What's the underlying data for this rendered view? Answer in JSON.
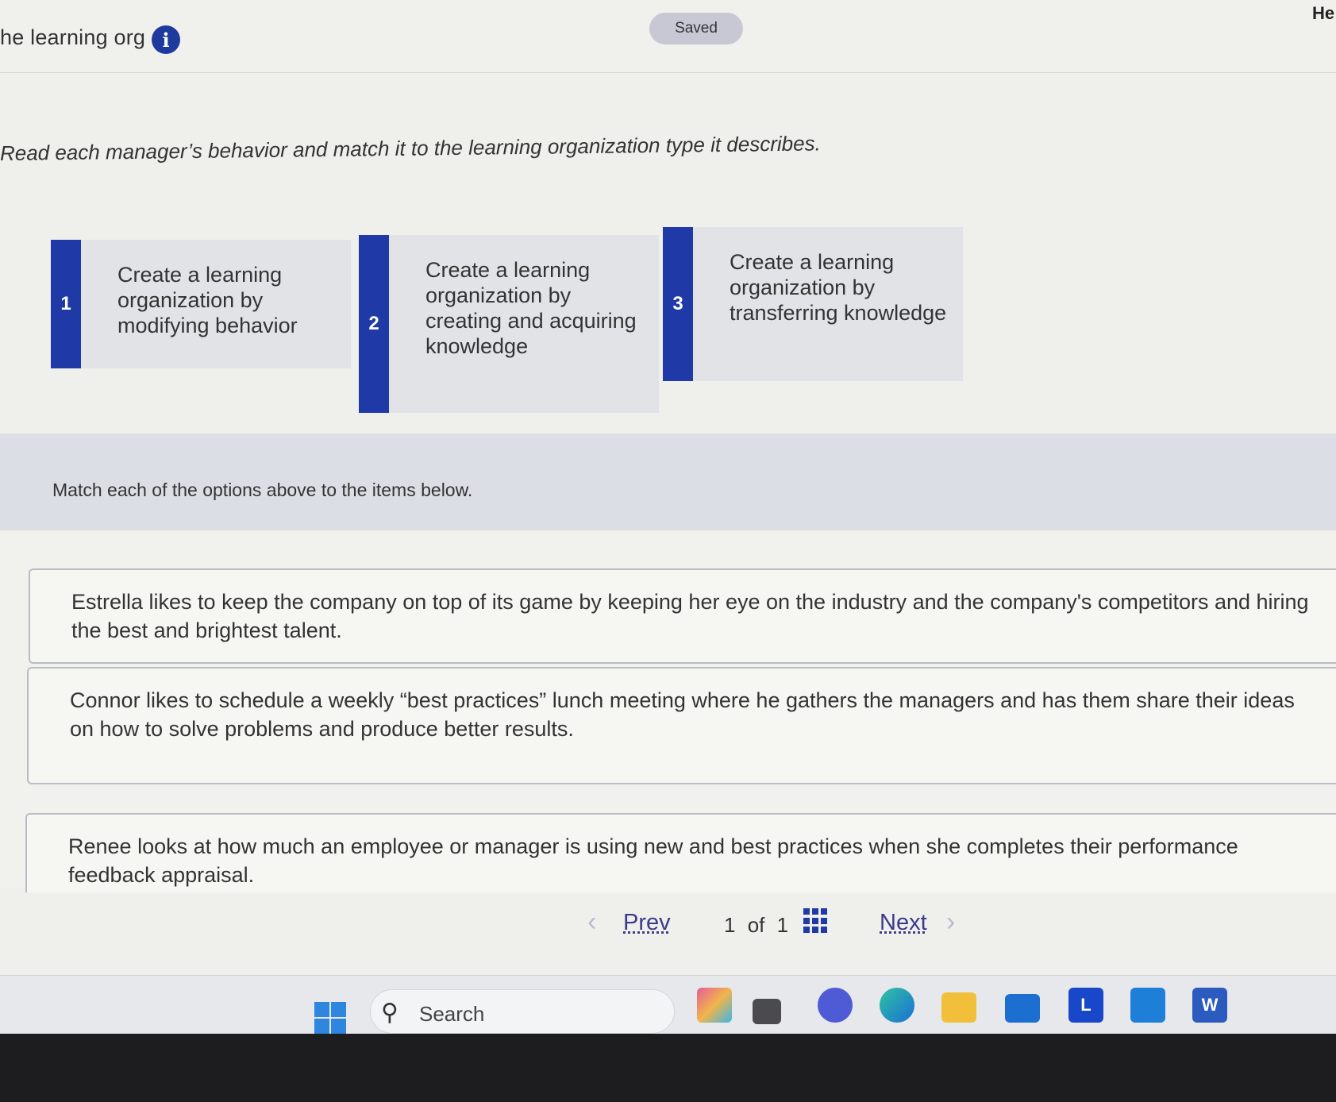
{
  "header": {
    "title": "he learning org",
    "saved_label": "Saved",
    "corner_text": "He"
  },
  "instruction": "Read each manager’s behavior and match it to the learning organization type it describes.",
  "options": [
    {
      "number": "1",
      "label": "Create a learning organization by modifying behavior"
    },
    {
      "number": "2",
      "label": "Create a learning organization by creating and acquiring knowledge"
    },
    {
      "number": "3",
      "label": "Create a learning organization by transferring knowledge"
    }
  ],
  "match_prompt": "Match each of the options above to the items below.",
  "items": [
    {
      "text": "Estrella likes to keep the company on top of its game by keeping her eye on the industry and the company's competitors and hiring the best and brightest talent."
    },
    {
      "text": "Connor likes to schedule a weekly “best practices” lunch meeting where he gathers the managers and has them share their ideas on how to solve problems and produce better results."
    },
    {
      "text": "Renee looks at how much an employee or manager is using new and best practices when she completes their performance feedback appraisal."
    }
  ],
  "pagination": {
    "prev_label": "Prev",
    "current": "1",
    "of_label": "of",
    "total": "1",
    "next_label": "Next"
  },
  "taskbar": {
    "search_label": "Search",
    "apps": [
      "copilot-icon",
      "file-viewer-icon",
      "chat-icon",
      "edge-icon",
      "file-explorer-icon",
      "mail-icon",
      "l-app-icon",
      "cortana-icon",
      "word-icon"
    ]
  },
  "colors": {
    "accent": "#1f3aa7",
    "option_bg": "#e2e3e6",
    "saved_bg": "#c7c8d4"
  }
}
